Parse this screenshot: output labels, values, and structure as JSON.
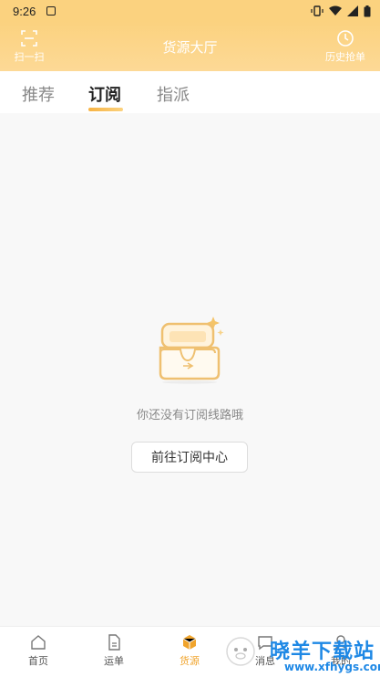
{
  "status_bar": {
    "time": "9:26"
  },
  "header": {
    "title": "货源大厅",
    "scan_label": "扫一扫",
    "history_label": "历史抢单"
  },
  "tabs": [
    {
      "label": "推荐"
    },
    {
      "label": "订阅"
    },
    {
      "label": "指派"
    }
  ],
  "empty_state": {
    "message": "你还没有订阅线路哦",
    "button_label": "前往订阅中心"
  },
  "bottom_nav": [
    {
      "label": "首页"
    },
    {
      "label": "运单"
    },
    {
      "label": "货源"
    },
    {
      "label": "消息"
    },
    {
      "label": "我的"
    }
  ],
  "watermark": {
    "text": "晓羊下载站",
    "sub": "www.xfhygs.com"
  },
  "colors": {
    "header": "#fbd27f",
    "accent": "#f0a42c",
    "watermark": "#1e88e5"
  }
}
